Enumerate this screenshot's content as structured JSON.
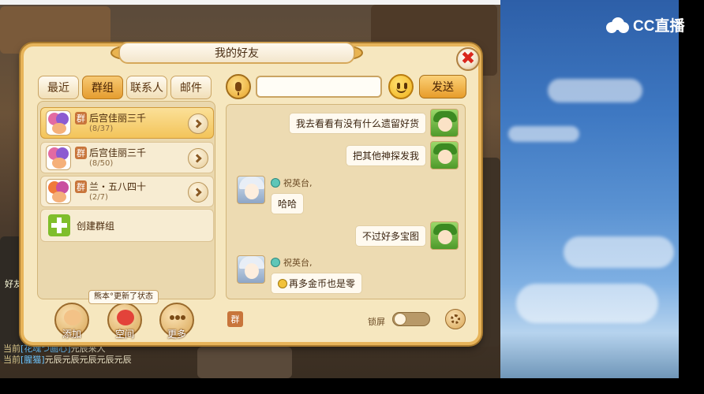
{
  "overlay": {
    "stream_logo": "CC直播"
  },
  "dialog": {
    "title": "我的好友",
    "close_label": "✖",
    "tabs": [
      {
        "label": "最近",
        "active": false
      },
      {
        "label": "群组",
        "active": true
      },
      {
        "label": "联系人",
        "active": false
      },
      {
        "label": "邮件",
        "active": false
      }
    ],
    "groups": [
      {
        "badge": "群",
        "name": "后宫佳丽三千",
        "count": "(8/37)",
        "active": true
      },
      {
        "badge": "群",
        "name": "后宫佳丽三千",
        "count": "(8/50)",
        "active": false
      },
      {
        "badge": "群",
        "name": "兰・五八四十",
        "count": "(2/7)",
        "active": false
      }
    ],
    "create_group_label": "创建群组",
    "status_tip": "熊本°更新了状态",
    "bottom_buttons": [
      {
        "label": "添加",
        "icon": "add-friend-icon"
      },
      {
        "label": "空间",
        "icon": "space-avatar-icon"
      },
      {
        "label": "更多",
        "icon": "more-icon"
      }
    ],
    "chat": {
      "input_value": "",
      "send_label": "发送",
      "messages": [
        {
          "from": "self",
          "text": "我去看看有没有什么遗留好货"
        },
        {
          "from": "self",
          "text": "把其他神探发我"
        },
        {
          "from": "other",
          "sender": "祝英台,",
          "text": "哈哈"
        },
        {
          "from": "self",
          "text": "不过好多宝图"
        },
        {
          "from": "other",
          "sender": "祝英台,",
          "text": "再多金币也是零"
        }
      ],
      "channel_badge": "群",
      "lock_label": "锁屏",
      "lock_on": false
    }
  },
  "game_chat": {
    "hud_label": "好友",
    "lines": [
      {
        "channel": "当前",
        "name": "[花魂つ画心]",
        "text": "元辰来人"
      },
      {
        "channel": "当前",
        "name": "[腥猫]",
        "text": "元辰元辰元辰元辰元辰"
      }
    ]
  },
  "colors": {
    "dialog_bg": "#f6e7bf",
    "accent": "#e79c2a",
    "close": "#d9261c"
  }
}
